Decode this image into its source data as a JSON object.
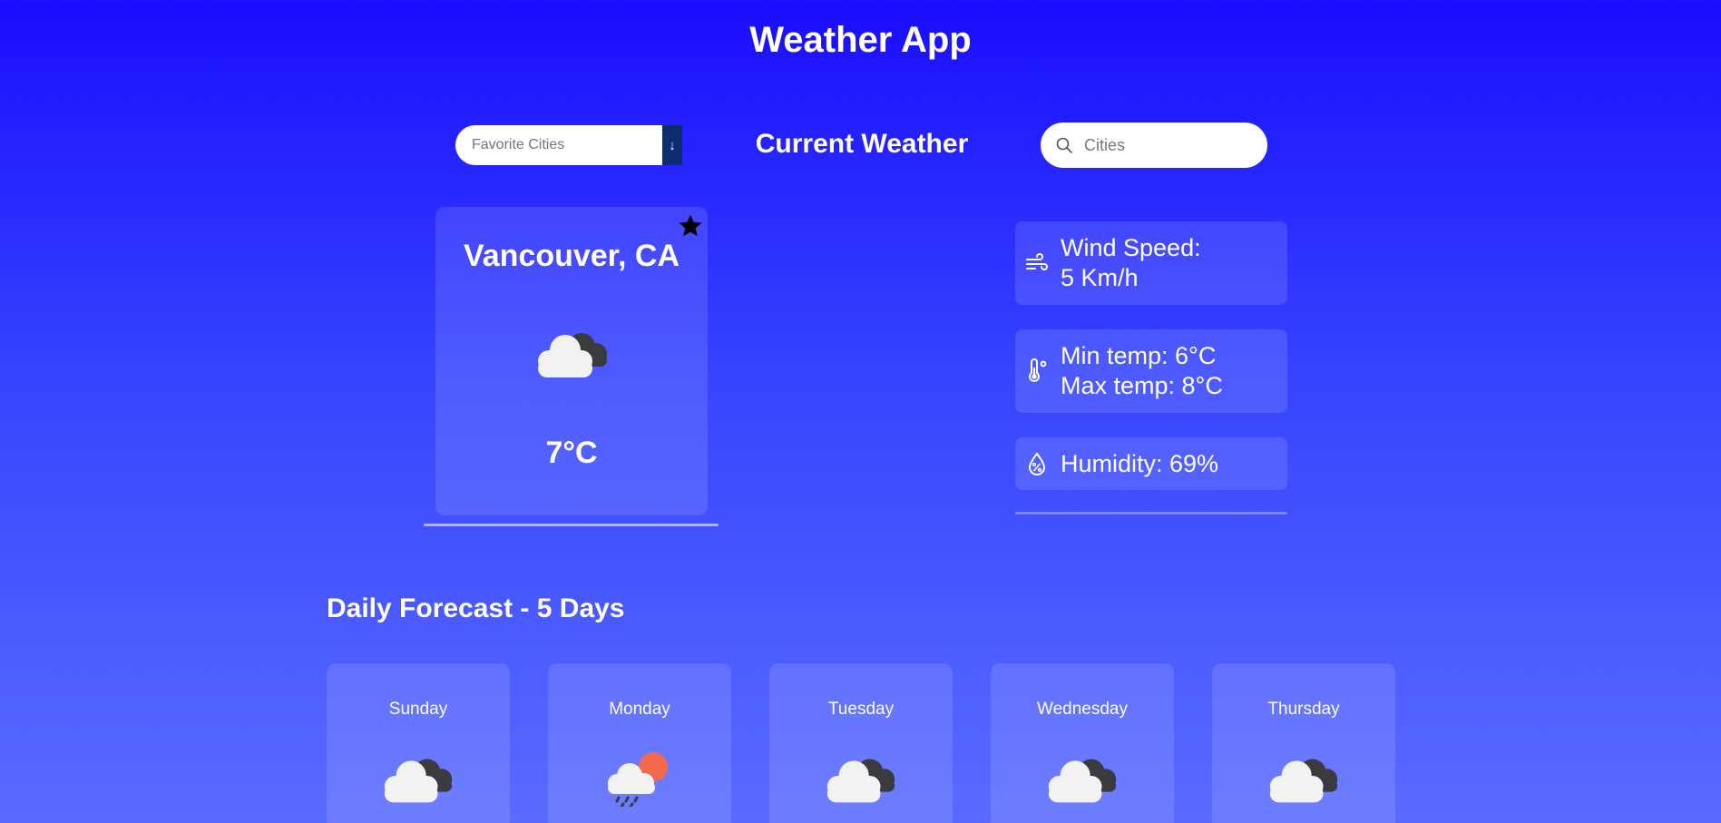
{
  "app": {
    "title": "Weather App"
  },
  "toolbar": {
    "favorites_placeholder": "Favorite Cities",
    "section_title": "Current Weather",
    "search_placeholder": "Cities"
  },
  "current": {
    "city": "Vancouver, CA",
    "temperature": "7°C",
    "condition_icon": "cloudy-icon",
    "favorited": true,
    "wind_line1": "Wind Speed:",
    "wind_line2": "5 Km/h",
    "min_temp": "Min temp: 6°C",
    "max_temp": "Max temp: 8°C",
    "humidity": "Humidity: 69%"
  },
  "forecast": {
    "title": "Daily Forecast - 5 Days",
    "days": [
      {
        "day": "Sunday",
        "icon": "cloudy-icon"
      },
      {
        "day": "Monday",
        "icon": "rain-sun-icon"
      },
      {
        "day": "Tuesday",
        "icon": "cloudy-icon"
      },
      {
        "day": "Wednesday",
        "icon": "cloudy-icon"
      },
      {
        "day": "Thursday",
        "icon": "cloudy-icon"
      }
    ]
  },
  "colors": {
    "background_top": "#1a0cff",
    "background_bottom": "#5a6cff",
    "select_arrow": "#0c2c6e",
    "sun": "#f26a4b"
  }
}
